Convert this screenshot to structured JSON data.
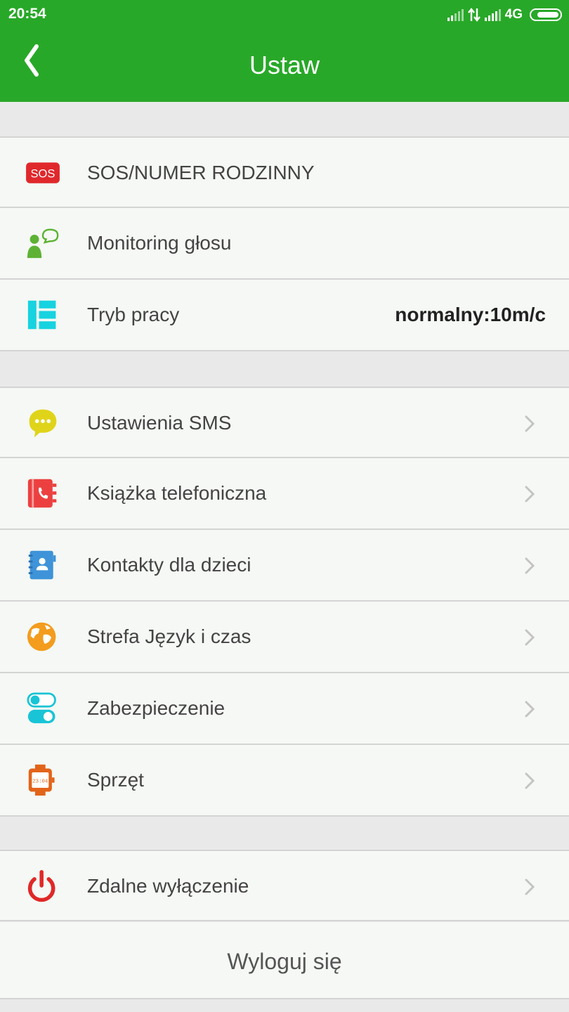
{
  "status_bar": {
    "time": "20:54",
    "network": "4G"
  },
  "header": {
    "title": "Ustaw"
  },
  "colors": {
    "header_green": "#28a828",
    "list_background": "#f5f8f4",
    "divider": "#d4d4d4"
  },
  "group1": [
    {
      "label": "SOS/NUMER RODZINNY",
      "icon": "sos-icon"
    },
    {
      "label": "Monitoring głosu",
      "icon": "voice-monitor-icon"
    },
    {
      "label": "Tryb pracy",
      "value": "normalny:10m/c",
      "icon": "work-mode-icon"
    }
  ],
  "group2": [
    {
      "label": "Ustawienia SMS",
      "icon": "sms-icon"
    },
    {
      "label": "Książka telefoniczna",
      "icon": "phonebook-icon"
    },
    {
      "label": "Kontakty dla dzieci",
      "icon": "contacts-icon"
    },
    {
      "label": "Strefa Język i czas",
      "icon": "globe-icon"
    },
    {
      "label": "Zabezpieczenie",
      "icon": "toggle-icon"
    },
    {
      "label": "Sprzęt",
      "icon": "watch-icon"
    }
  ],
  "group3": [
    {
      "label": "Zdalne wyłączenie",
      "icon": "power-icon"
    }
  ],
  "logout": {
    "label": "Wyloguj się"
  }
}
